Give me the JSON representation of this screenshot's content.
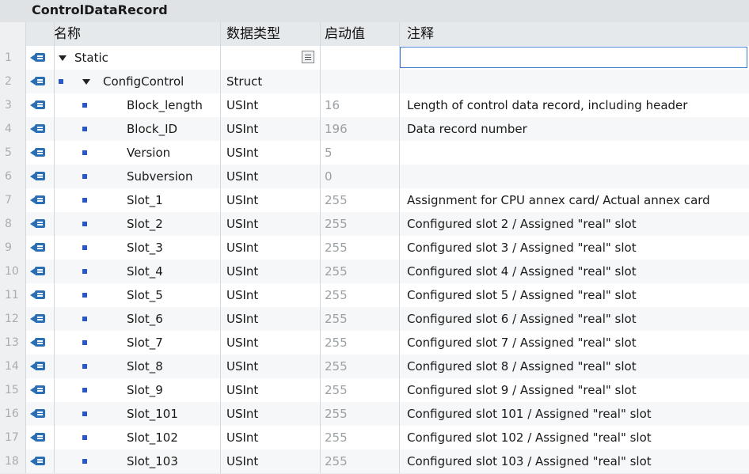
{
  "title": "ControlDataRecord",
  "columns": {
    "name": "名称",
    "type": "数据类型",
    "start": "启动值",
    "comment": "注释"
  },
  "rows": [
    {
      "num": "1",
      "name": "Static",
      "type": "",
      "start": "",
      "comment": "",
      "level": 0,
      "expand": true
    },
    {
      "num": "2",
      "name": "ConfigControl",
      "type": "Struct",
      "start": "",
      "comment": "",
      "level": 1,
      "expand": true
    },
    {
      "num": "3",
      "name": "Block_length",
      "type": "USInt",
      "start": "16",
      "comment": "Length of control data record, including header",
      "level": 2
    },
    {
      "num": "4",
      "name": "Block_ID",
      "type": "USInt",
      "start": "196",
      "comment": "Data record number",
      "level": 2
    },
    {
      "num": "5",
      "name": "Version",
      "type": "USInt",
      "start": "5",
      "comment": "",
      "level": 2
    },
    {
      "num": "6",
      "name": "Subversion",
      "type": "USInt",
      "start": "0",
      "comment": "",
      "level": 2
    },
    {
      "num": "7",
      "name": "Slot_1",
      "type": "USInt",
      "start": "255",
      "comment": "Assignment for CPU annex card/ Actual annex card",
      "level": 2
    },
    {
      "num": "8",
      "name": "Slot_2",
      "type": "USInt",
      "start": "255",
      "comment": "Configured slot 2 / Assigned \"real\" slot",
      "level": 2
    },
    {
      "num": "9",
      "name": "Slot_3",
      "type": "USInt",
      "start": "255",
      "comment": "Configured slot 3 / Assigned \"real\" slot",
      "level": 2
    },
    {
      "num": "10",
      "name": "Slot_4",
      "type": "USInt",
      "start": "255",
      "comment": "Configured slot 4 / Assigned \"real\" slot",
      "level": 2
    },
    {
      "num": "11",
      "name": "Slot_5",
      "type": "USInt",
      "start": "255",
      "comment": "Configured slot 5 / Assigned \"real\" slot",
      "level": 2
    },
    {
      "num": "12",
      "name": "Slot_6",
      "type": "USInt",
      "start": "255",
      "comment": "Configured slot 6 / Assigned \"real\" slot",
      "level": 2
    },
    {
      "num": "13",
      "name": "Slot_7",
      "type": "USInt",
      "start": "255",
      "comment": "Configured slot 7 / Assigned \"real\" slot",
      "level": 2
    },
    {
      "num": "14",
      "name": "Slot_8",
      "type": "USInt",
      "start": "255",
      "comment": "Configured slot 8 / Assigned \"real\" slot",
      "level": 2
    },
    {
      "num": "15",
      "name": "Slot_9",
      "type": "USInt",
      "start": "255",
      "comment": "Configured slot 9 / Assigned \"real\" slot",
      "level": 2
    },
    {
      "num": "16",
      "name": "Slot_101",
      "type": "USInt",
      "start": "255",
      "comment": "Configured slot 101 / Assigned \"real\" slot",
      "level": 2
    },
    {
      "num": "17",
      "name": "Slot_102",
      "type": "USInt",
      "start": "255",
      "comment": "Configured slot 102 / Assigned \"real\" slot",
      "level": 2
    },
    {
      "num": "18",
      "name": "Slot_103",
      "type": "USInt",
      "start": "255",
      "comment": "Configured slot 103 / Assigned \"real\" slot",
      "level": 2
    }
  ],
  "icons": {
    "interface": "input-output-icon",
    "member": "member-bullet-icon",
    "expand": "expand-triangle-icon",
    "picker": "list-picker-icon"
  },
  "colors": {
    "accent": "#2a6fb5",
    "selection": "#3b7bd1",
    "header_bg": "#e6e9eb"
  }
}
